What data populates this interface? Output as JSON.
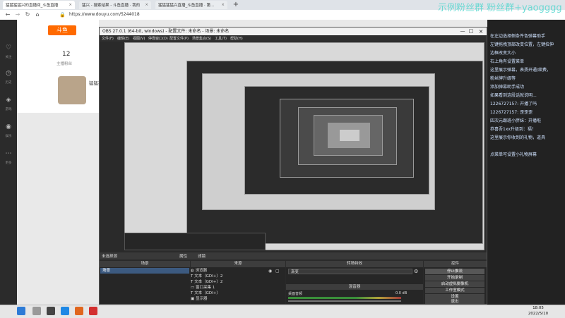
{
  "browser": {
    "tabs": [
      {
        "label": "猛猛猛猛兴的直播间_斗鱼直播"
      },
      {
        "label": "猛兴 - 搜索结果 - 斗鱼直播 · 我的"
      },
      {
        "label": "猛猛猛猛兴直播_斗鱼直播 · 第..."
      }
    ],
    "new_tab": "+",
    "close": "×",
    "url": "https://www.douyu.com/5244018"
  },
  "watermark": "示例粉丝群 粉丝群+yaogggg",
  "page": {
    "room_logo": "斗鱼",
    "followers_count": "12",
    "followers_label": "主播粉丝",
    "streamer_name": "猛猛兴",
    "nav": [
      "关注",
      "历史",
      "游戏",
      "娱乐",
      "更多"
    ]
  },
  "chat": [
    "在左边选择侧条件色弹幕助手",
    "左键拖拽顶部改变位置，左键拉伸",
    "边框改变大小",
    "右上角有设置菜单",
    "这里展示弹幕，表扬开通/续费，",
    "粉丝牌升级等",
    "添加弹幕助手成功",
    "如果看到这段话就说明...",
    "1226727157: 开播了吗",
    "1226727157: 歪歪歪",
    "四次元跟班小胖妹：开播啦",
    "恭喜吾1xx升级到：福！",
    "这里展示你收到的礼物，道具",
    "",
    "点菜单可设置小礼物屏幕"
  ],
  "obs": {
    "title": "OBS 27.0.1 (64-bit, windows) - 配置文件: 未命名 - 场景: 未命名",
    "menu": [
      "文件(F)",
      "编辑(E)",
      "视图(V)",
      "停靠窗口(D)",
      "配置文件(P)",
      "场景集合(S)",
      "工具(T)",
      "帮助(H)"
    ],
    "no_source": "未选择源",
    "properties_label": "属性",
    "filters_label": "滤镜",
    "docks": {
      "scenes": "场景",
      "sources": "来源",
      "audio_mixer": "混音器",
      "transitions": "转场特效",
      "controls": "控件"
    },
    "scene_item": "场景",
    "sources": [
      "浏览器",
      "文本（GDI+）2",
      "文本（GDI+）2",
      "窗口采集 1",
      "文本（GDI+）",
      "显示器"
    ],
    "mixer_label": "桌面音频",
    "mixer_db": "0.0 dB",
    "transition_value": "渐变",
    "controls": [
      "停止推流",
      "开始录制",
      "启动虚拟摄像机",
      "工作室模式",
      "设置",
      "退出"
    ]
  },
  "taskbar": {
    "time": "18:05",
    "date": "2022/5/10"
  }
}
